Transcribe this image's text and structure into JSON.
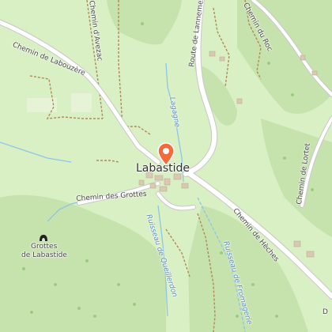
{
  "town": {
    "name": "Labastide"
  },
  "marker": {
    "icon": "location-pin-icon",
    "color": "#f46a3b"
  },
  "poi": {
    "icon": "cave-icon",
    "line1": "Grottes",
    "line2": "de Labastide"
  },
  "roads": {
    "chemin_de_labouzere": "Chemin de Labouzère",
    "chemin_d_avezac": "Chemin d'Avezac",
    "route_de_lannemezan": "Route de Lannemezan",
    "chemin_du_roc": "Chemin du Roc",
    "chemin_des_grottes": "Chemin des Grottes",
    "chemin_de_heches": "Chemin de Hèches",
    "chemin_de_lortet": "Chemin de Lortet",
    "d_label": "D"
  },
  "water": {
    "lagagne": "Lagagne",
    "ruisseau_de_queillerdon": "Ruisseau de Queillerdon",
    "ruisseau_de_fromagerie": "Ruisseau de Fromagerie"
  },
  "colors": {
    "land": "#d9efc4",
    "forest": "#c6e2ad",
    "road": "#ffffff",
    "stream": "#8ec6e6",
    "track": "#b08a5a",
    "building": "#d8c9b2"
  }
}
